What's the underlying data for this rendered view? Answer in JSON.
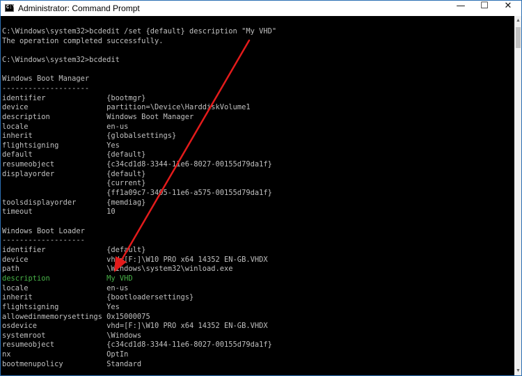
{
  "window": {
    "icon_label": "C:\\",
    "title": "Administrator: Command Prompt",
    "minimize_glyph": "—",
    "maximize_glyph": "☐",
    "close_glyph": "✕",
    "icon": "command-prompt-icon"
  },
  "scrollbar": {
    "up_glyph": "▲",
    "down_glyph": "▼"
  },
  "console": {
    "lines": [
      "C:\\Windows\\system32>bcdedit /set {default} description \"My VHD\"",
      "The operation completed successfully.",
      "",
      "C:\\Windows\\system32>bcdedit",
      "",
      "Windows Boot Manager",
      "--------------------",
      "identifier              {bootmgr}",
      "device                  partition=\\Device\\HarddiskVolume1",
      "description             Windows Boot Manager",
      "locale                  en-us",
      "inherit                 {globalsettings}",
      "flightsigning           Yes",
      "default                 {default}",
      "resumeobject            {c34cd1d8-3344-11e6-8027-00155d79da1f}",
      "displayorder            {default}",
      "                        {current}",
      "                        {ff1a09c7-3405-11e6-a575-00155d79da1f}",
      "toolsdisplayorder       {memdiag}",
      "timeout                 10",
      "",
      "Windows Boot Loader",
      "-------------------",
      "identifier              {default}",
      "device                  vhd=[F:]\\W10 PRO x64 14352 EN-GB.VHDX",
      "path                    \\Windows\\system32\\winload.exe",
      "description             My VHD",
      "locale                  en-us",
      "inherit                 {bootloadersettings}",
      "flightsigning           Yes",
      "allowedinmemorysettings 0x15000075",
      "osdevice                vhd=[F:]\\W10 PRO x64 14352 EN-GB.VHDX",
      "systemroot              \\Windows",
      "resumeobject            {c34cd1d8-3344-11e6-8027-00155d79da1f}",
      "nx                      OptIn",
      "bootmenupolicy          Standard"
    ],
    "highlight_line": 26,
    "text_color": "#c0c0c0",
    "highlight_color": "#48b348"
  },
  "annotation": {
    "color": "#e31b1b"
  }
}
